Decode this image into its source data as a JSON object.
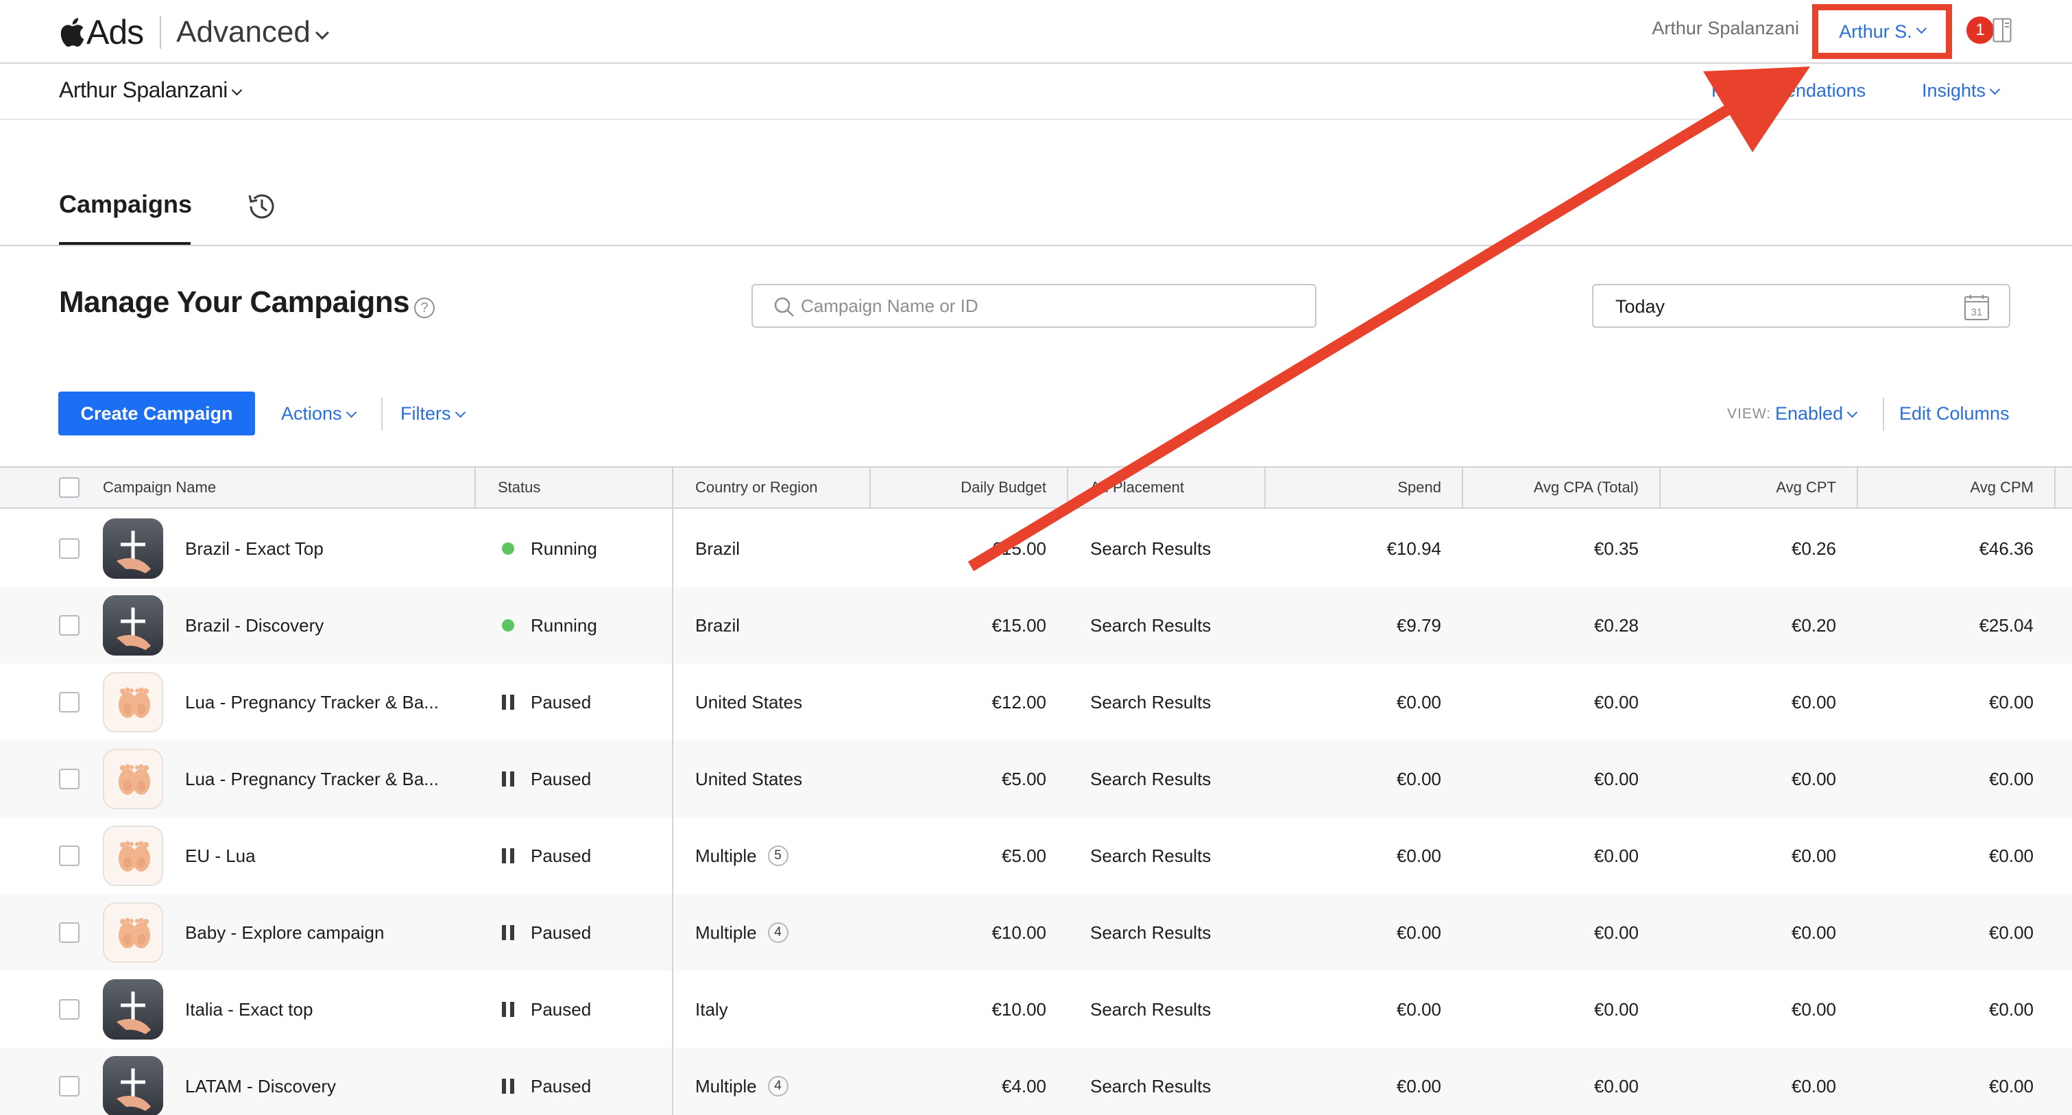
{
  "header": {
    "brand": "Ads",
    "mode": "Advanced",
    "user_name": "Arthur Spalanzani",
    "account_label": "Arthur S.",
    "notification_count": "1"
  },
  "subheader": {
    "org_name": "Arthur Spalanzani",
    "recommendations": "Recommendations",
    "insights": "Insights"
  },
  "tabs": {
    "campaigns": "Campaigns"
  },
  "page": {
    "title": "Manage Your Campaigns",
    "help": "?",
    "search_placeholder": "Campaign Name or ID",
    "date_range": "Today",
    "calendar_day": "31"
  },
  "toolbar": {
    "create": "Create Campaign",
    "actions": "Actions",
    "filters": "Filters",
    "view_label": "VIEW:",
    "view_value": "Enabled",
    "edit_columns": "Edit Columns"
  },
  "table": {
    "columns": {
      "name": "Campaign Name",
      "status": "Status",
      "country": "Country or Region",
      "budget": "Daily Budget",
      "placement": "Ad Placement",
      "spend": "Spend",
      "cpa": "Avg CPA (Total)",
      "cpt": "Avg CPT",
      "cpm": "Avg CPM"
    },
    "rows": [
      {
        "name": "Brazil - Exact Top",
        "icon": "dark",
        "status": "Running",
        "country": "Brazil",
        "count": "",
        "budget": "€15.00",
        "placement": "Search Results",
        "spend": "€10.94",
        "cpa": "€0.35",
        "cpt": "€0.26",
        "cpm": "€46.36"
      },
      {
        "name": "Brazil - Discovery",
        "icon": "dark",
        "status": "Running",
        "country": "Brazil",
        "count": "",
        "budget": "€15.00",
        "placement": "Search Results",
        "spend": "€9.79",
        "cpa": "€0.28",
        "cpt": "€0.20",
        "cpm": "€25.04"
      },
      {
        "name": "Lua - Pregnancy Tracker & Ba...",
        "icon": "light",
        "status": "Paused",
        "country": "United States",
        "count": "",
        "budget": "€12.00",
        "placement": "Search Results",
        "spend": "€0.00",
        "cpa": "€0.00",
        "cpt": "€0.00",
        "cpm": "€0.00"
      },
      {
        "name": "Lua - Pregnancy Tracker & Ba...",
        "icon": "light",
        "status": "Paused",
        "country": "United States",
        "count": "",
        "budget": "€5.00",
        "placement": "Search Results",
        "spend": "€0.00",
        "cpa": "€0.00",
        "cpt": "€0.00",
        "cpm": "€0.00"
      },
      {
        "name": "EU - Lua",
        "icon": "light",
        "status": "Paused",
        "country": "Multiple",
        "count": "5",
        "budget": "€5.00",
        "placement": "Search Results",
        "spend": "€0.00",
        "cpa": "€0.00",
        "cpt": "€0.00",
        "cpm": "€0.00"
      },
      {
        "name": "Baby - Explore campaign",
        "icon": "light",
        "status": "Paused",
        "country": "Multiple",
        "count": "4",
        "budget": "€10.00",
        "placement": "Search Results",
        "spend": "€0.00",
        "cpa": "€0.00",
        "cpt": "€0.00",
        "cpm": "€0.00"
      },
      {
        "name": "Italia - Exact top",
        "icon": "dark",
        "status": "Paused",
        "country": "Italy",
        "count": "",
        "budget": "€10.00",
        "placement": "Search Results",
        "spend": "€0.00",
        "cpa": "€0.00",
        "cpt": "€0.00",
        "cpm": "€0.00"
      },
      {
        "name": "LATAM - Discovery",
        "icon": "dark",
        "status": "Paused",
        "country": "Multiple",
        "count": "4",
        "budget": "€4.00",
        "placement": "Search Results",
        "spend": "€0.00",
        "cpa": "€0.00",
        "cpt": "€0.00",
        "cpm": "€0.00"
      }
    ]
  },
  "colors": {
    "accent": "#2a6ed9",
    "button": "#1c6ef2",
    "annotation": "#e8412c",
    "running": "#5dc560",
    "badge": "#e33124"
  }
}
